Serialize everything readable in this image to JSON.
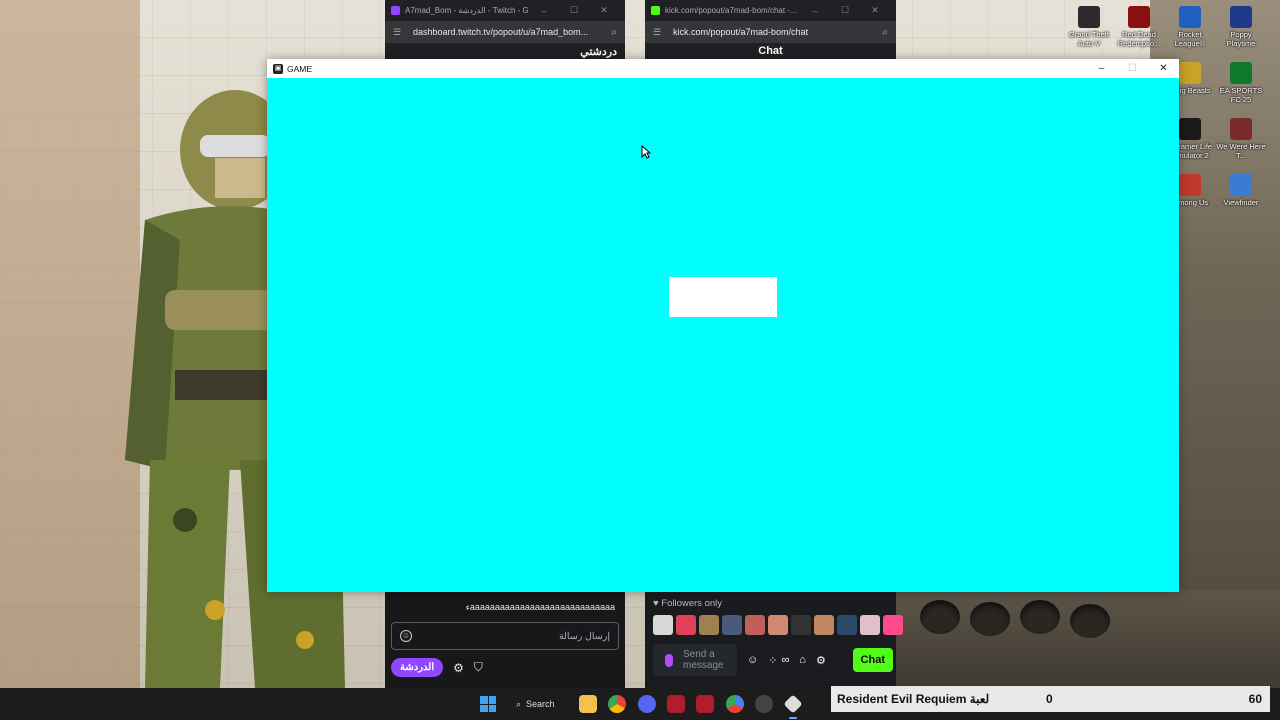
{
  "game_window": {
    "title": "GAME",
    "minimize": "–",
    "maximize": "☐",
    "close": "✕"
  },
  "twitch_window": {
    "tab_title": "A7mad_Bom - الدردشة - Twitch - Go...",
    "url": "dashboard.twitch.tv/popout/u/a7mad_bom...",
    "header": "دردشتي",
    "last_message": "ءaaaaaaaaaaaaaaaaaaaaaaaaaaaaa",
    "input_placeholder": "إرسال رسالة",
    "chat_button": "الدردشة"
  },
  "kick_window": {
    "tab_title": "kick.com/popout/a7mad-bom/chat -...",
    "url": "kick.com/popout/a7mad-bom/chat",
    "header": "Chat",
    "followers_only": "Followers only",
    "input_placeholder_line1": "Send a",
    "input_placeholder_line2": "message",
    "chat_button": "Chat"
  },
  "desktop_icons": [
    {
      "label": "Grand Theft Auto V",
      "color": "#2b2b2b"
    },
    {
      "label": "Red Dead Redemptio...",
      "color": "#8a1010"
    },
    {
      "label": "Rocket League®",
      "color": "#1e5fbf"
    },
    {
      "label": "Poppy Playtime",
      "color": "#1f3a8a"
    },
    {
      "label": "...ing Beasts",
      "color": "#c9a227"
    },
    {
      "label": "EA SPORTS FC 25",
      "color": "#0d7a2b"
    },
    {
      "label": "...reamer Life ...mulator 2",
      "color": "#1a1a1a"
    },
    {
      "label": "We Were Here T...",
      "color": "#7a2a2a"
    },
    {
      "label": "...mong Us",
      "color": "#c0392b"
    },
    {
      "label": "Viewfinder",
      "color": "#3a7bd5"
    }
  ],
  "taskbar": {
    "search_label": "Search"
  },
  "overlay": {
    "game_name": "Resident Evil Requiem لعبة",
    "count": "0",
    "fps": "60"
  },
  "colors": {
    "game_bg": "#00ffff",
    "twitch_purple": "#9147ff",
    "kick_green": "#53fc18"
  }
}
